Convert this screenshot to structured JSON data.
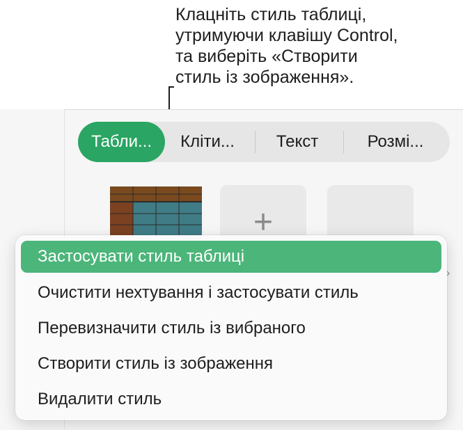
{
  "callout": {
    "text": "Клацніть стиль таблиці,\nутримуючи клавішу Control,\nта виберіть «Створити\nстиль із зображення»."
  },
  "tabs": [
    {
      "label": "Табли..."
    },
    {
      "label": "Кліти..."
    },
    {
      "label": "Текст"
    },
    {
      "label": "Розмі..."
    }
  ],
  "styles": {
    "add_label": "+"
  },
  "context_menu": {
    "items": [
      {
        "label": "Застосувати стиль таблиці"
      },
      {
        "label": "Очистити нехтування і застосувати стиль"
      },
      {
        "label": "Перевизначити стиль із вибраного"
      },
      {
        "label": "Створити стиль із зображення"
      },
      {
        "label": "Видалити стиль"
      }
    ],
    "highlighted_item": "Застосувати стиль таблиці"
  },
  "colors": {
    "accent_tab": "#2aa563",
    "menu_highlight": "#4cb57a",
    "thumb_header": "#7a4a1e",
    "thumb_body": "#3f7c86"
  }
}
